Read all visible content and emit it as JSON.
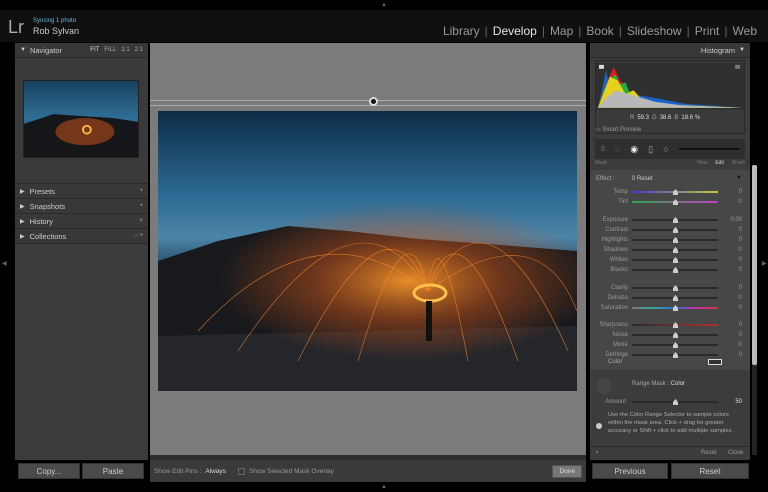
{
  "identity": {
    "sync_status": "Syncing 1 photo",
    "user_name": "Rob Sylvan",
    "logo": "Lr"
  },
  "modules": [
    "Library",
    "Develop",
    "Map",
    "Book",
    "Slideshow",
    "Print",
    "Web"
  ],
  "active_module": "Develop",
  "left_panel": {
    "navigator": {
      "title": "Navigator",
      "zoom_options": [
        "FIT",
        "FILL",
        "1:1",
        "2:1"
      ]
    },
    "panels": [
      {
        "label": "Presets",
        "action": "+"
      },
      {
        "label": "Snapshots",
        "action": "+"
      },
      {
        "label": "History",
        "action": "×"
      },
      {
        "label": "Collections",
        "action": "− +"
      }
    ],
    "copy_button": "Copy...",
    "paste_button": "Paste"
  },
  "toolbar": {
    "edit_pins_label": "Show Edit Pins :",
    "edit_pins_value": "Always",
    "mask_overlay_label": "Show Selected Mask Overlay",
    "done_button": "Done"
  },
  "right_panel": {
    "histogram_title": "Histogram",
    "rgb": {
      "r_label": "R",
      "r": "59.3",
      "g_label": "G",
      "g": "38.6",
      "b_label": "B",
      "b": "18.6 %"
    },
    "smart_preview": "Smart Preview",
    "mask_row": {
      "label": "Mask :",
      "new": "New",
      "edit": "Edit",
      "brush": "Brush"
    },
    "effect": {
      "label": "Effect :",
      "value": "0 Reset"
    },
    "sliders": [
      {
        "label": "Temp",
        "value": "0",
        "track": "temp"
      },
      {
        "label": "Tint",
        "value": "0",
        "track": "tint"
      },
      {
        "label": "Exposure",
        "value": "0.00"
      },
      {
        "label": "Contrast",
        "value": "0"
      },
      {
        "label": "Highlights",
        "value": "0"
      },
      {
        "label": "Shadows",
        "value": "0"
      },
      {
        "label": "Whites",
        "value": "0"
      },
      {
        "label": "Blacks",
        "value": "0"
      },
      {
        "label": "Clarity",
        "value": "0"
      },
      {
        "label": "Dehaze",
        "value": "0"
      },
      {
        "label": "Saturation",
        "value": "0",
        "track": "sat"
      },
      {
        "label": "Sharpness",
        "value": "0",
        "track": "sharp"
      },
      {
        "label": "Noise",
        "value": "0"
      },
      {
        "label": "Moiré",
        "value": "0"
      },
      {
        "label": "Defringe",
        "value": "0"
      }
    ],
    "color_label": "Color",
    "range_mask": {
      "label": "Range Mask :",
      "value": "Color",
      "amount_label": "Amount",
      "amount": "50",
      "help": "Use the Color Range Selector to sample colors within the mask area. Click + drag for greater accuracy or Shift + click to add multiple samples."
    },
    "reset_label": "Reset",
    "close_label": "Close",
    "previous_button": "Previous",
    "reset_button": "Reset"
  }
}
